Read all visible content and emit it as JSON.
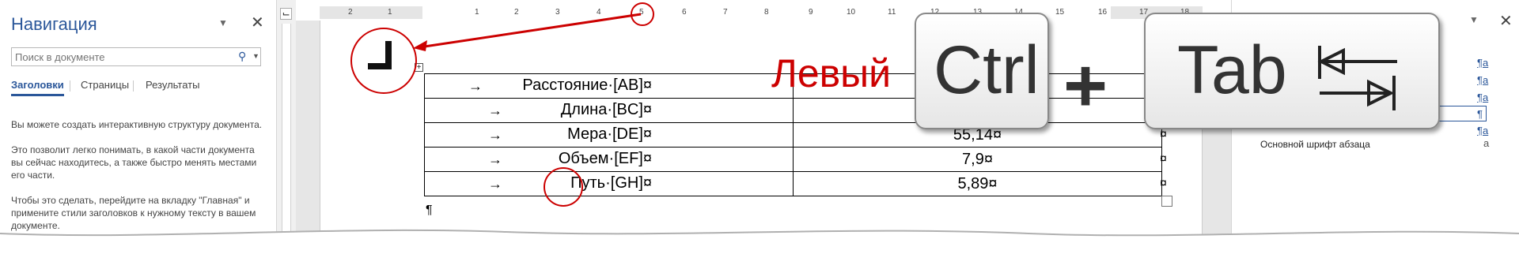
{
  "navigation": {
    "title": "Навигация",
    "search_placeholder": "Поиск в документе",
    "tabs": [
      "Заголовки",
      "Страницы",
      "Результаты"
    ],
    "paragraphs": [
      "Вы можете создать интерактивную структуру документа.",
      "Это позволит легко понимать, в какой части документа вы сейчас находитесь, а также быстро менять местами его части.",
      "Чтобы это сделать, перейдите на вкладку \"Главная\" и примените стили заголовков к нужному тексту в вашем документе."
    ]
  },
  "ruler": {
    "numbers": [
      "2",
      "1",
      "1",
      "1",
      "2",
      "3",
      "4",
      "5",
      "6",
      "7",
      "8",
      "9",
      "10",
      "11",
      "12",
      "13",
      "14",
      "15",
      "16",
      "17",
      "18"
    ],
    "vertical_tab_selector": "⌙"
  },
  "table": {
    "rows": [
      {
        "label": "Расстояние·[AB]¤",
        "value": "¤"
      },
      {
        "label": "Длина·[BC]¤",
        "value": ""
      },
      {
        "label": "Мера·[DE]¤",
        "value": "55,14¤"
      },
      {
        "label": "Объем·[EF]¤",
        "value": "7,9¤"
      },
      {
        "label": "Путь·[GH]¤",
        "value": "5,89¤"
      }
    ],
    "arrow": "→",
    "row_end": "¤",
    "paragraph_mark": "¶"
  },
  "styles_pane": {
    "marks": [
      "¶a",
      "¶a",
      "¶a",
      "¶",
      "¶a"
    ],
    "default_font_label": "Основной шрифт абзаца",
    "default_font_mark": "a"
  },
  "overlay": {
    "caption": "Левый",
    "keys": [
      "Ctrl",
      "Tab"
    ],
    "plus": "+",
    "tab_icon": "tab-icon"
  },
  "colors": {
    "accent": "#2b579a",
    "annotation": "#cc0000"
  }
}
